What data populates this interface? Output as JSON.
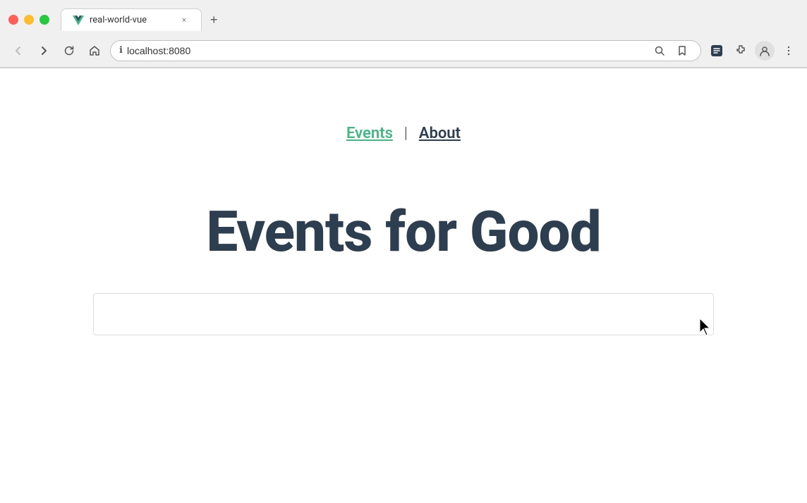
{
  "browser": {
    "tab": {
      "favicon_alt": "Vue logo",
      "title": "real-world-vue",
      "close_label": "×"
    },
    "new_tab_label": "+",
    "nav": {
      "back_label": "←",
      "forward_label": "→",
      "reload_label": "↻",
      "home_label": "⌂"
    },
    "address_bar": {
      "security_icon": "ℹ",
      "url": "localhost:8080",
      "zoom_icon": "🔍",
      "bookmark_icon": "☆"
    },
    "extensions": {
      "ext1_label": "ext1",
      "ext2_label": "🧩",
      "avatar_label": "👤",
      "menu_label": "⋮"
    }
  },
  "page": {
    "nav": {
      "events_label": "Events",
      "separator": "|",
      "about_label": "About"
    },
    "hero": {
      "title": "Events for Good"
    }
  }
}
